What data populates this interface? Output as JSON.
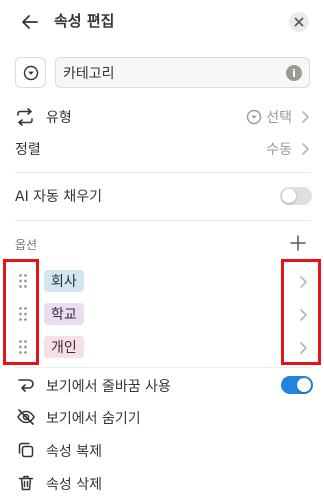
{
  "header": {
    "title": "속성 편집"
  },
  "name_field": {
    "value": "카테고리"
  },
  "rows": {
    "type": {
      "label": "유형",
      "value": "선택"
    },
    "sort": {
      "label": "정렬",
      "value": "수동"
    },
    "ai_autofill": {
      "label": "AI 자동 채우기",
      "enabled": false
    }
  },
  "options_section": {
    "label": "옵션",
    "options": [
      {
        "label": "회사",
        "bg": "#d3e5ef",
        "fg": "#183347"
      },
      {
        "label": "학교",
        "bg": "#e8deee",
        "fg": "#412454"
      },
      {
        "label": "개인",
        "bg": "#f5e0e9",
        "fg": "#4c2337"
      }
    ]
  },
  "actions": {
    "wrap": {
      "label": "보기에서 줄바꿈 사용",
      "enabled": true
    },
    "hide": {
      "label": "보기에서 숨기기"
    },
    "duplicate": {
      "label": "속성 복제"
    },
    "delete": {
      "label": "속성 삭제"
    }
  },
  "colors": {
    "accent": "#2383e2",
    "highlight": "#e4141b"
  }
}
